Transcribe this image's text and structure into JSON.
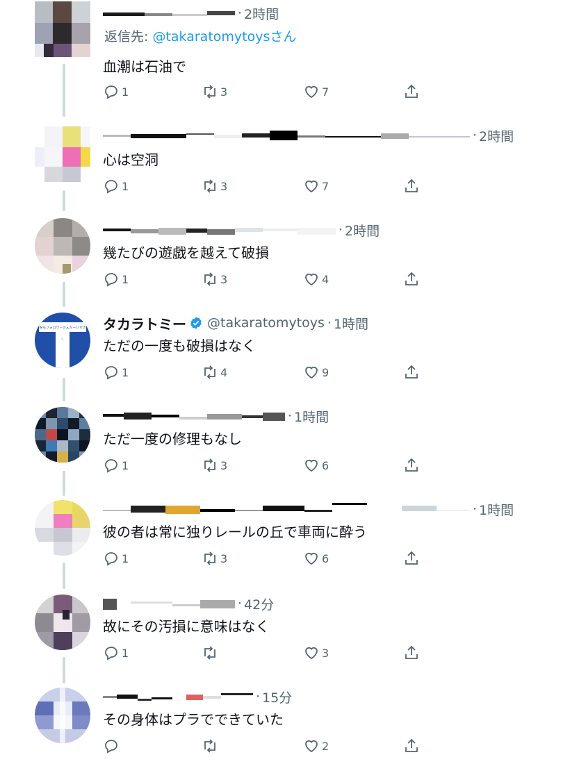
{
  "colors": {
    "accent": "#1d9bf0",
    "secondary_text": "#536471",
    "primary_text": "#0f1419",
    "verified": "#1d9bf0",
    "thread_line": "#cfd9de"
  },
  "tweets": [
    {
      "time": "2時間",
      "reply_label": "返信先: ",
      "reply_mention": "@takaratomytoys",
      "reply_suffix": "さん",
      "text": "血潮は石油で",
      "replies": "1",
      "retweets": "3",
      "likes": "7"
    },
    {
      "time": "2時間",
      "text": "心は空洞",
      "replies": "1",
      "retweets": "3",
      "likes": "7"
    },
    {
      "time": "2時間",
      "text": "幾たびの遊戯を越えて破損",
      "replies": "1",
      "retweets": "3",
      "likes": "4"
    },
    {
      "name": "タカラトミー",
      "handle": "@takaratomytoys",
      "time": "1時間",
      "text": "ただの一度も破損はなく",
      "replies": "1",
      "retweets": "4",
      "likes": "9",
      "avatar_logo_text": "お祝もフォロワーさんだーいすき。"
    },
    {
      "time": "1時間",
      "text": "ただ一度の修理もなし",
      "replies": "1",
      "retweets": "3",
      "likes": "6"
    },
    {
      "time": "1時間",
      "text": "彼の者は常に独りレールの丘で車両に酔う",
      "replies": "1",
      "retweets": "3",
      "likes": "6"
    },
    {
      "time": "42分",
      "text": "故にその汚損に意味はなく",
      "replies": "1",
      "retweets": "",
      "likes": "3"
    },
    {
      "time": "15分",
      "text": "その身体はプラでできていた",
      "replies": "",
      "retweets": "",
      "likes": "2"
    }
  ],
  "icons": {
    "reply": "reply-icon",
    "retweet": "retweet-icon",
    "like": "heart-icon",
    "share": "share-icon",
    "verified": "verified-badge-icon"
  }
}
